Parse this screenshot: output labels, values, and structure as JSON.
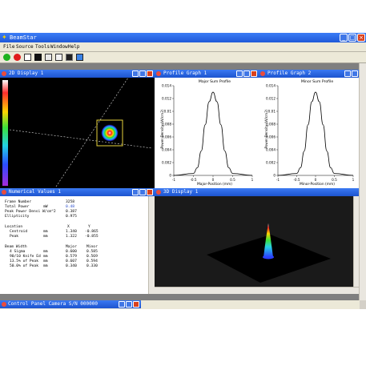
{
  "app": {
    "title": "BeamStar",
    "icon": "beamstar-app-icon",
    "window_buttons": [
      "_",
      "□",
      "×"
    ]
  },
  "menu": [
    "File",
    "Source",
    "Tools",
    "Window",
    "Help"
  ],
  "toolbar": {
    "buttons": [
      "start-green-icon",
      "stop-red-icon",
      "display-icon",
      "black-square-icon",
      "graph-icon",
      "window-icon",
      "panel-icon",
      "grid-icon"
    ]
  },
  "windows": {
    "display2d": {
      "title": "2D Display 1"
    },
    "profile1": {
      "title": "Profile Graph 1",
      "chart_title": "Major Sum Profile",
      "xlabel": "Major-Position (mm)",
      "ylabel": "Power Density (W/cm2)"
    },
    "profile2": {
      "title": "Profile Graph 2",
      "chart_title": "Minor Sum Profile",
      "xlabel": "Minor-Position (mm)",
      "ylabel": "Power Density (W/cm2)"
    },
    "numerical": {
      "title": "Numerical Values 1"
    },
    "display3d": {
      "title": "3D Display 1"
    },
    "control_panel": {
      "title": "Control Panel Camera S/N 000000"
    }
  },
  "numerical_values": {
    "frame_number_label": "Frame Number",
    "frame_number": "3258",
    "total_power_label": "Total Power",
    "total_power_unit": "mW",
    "total_power": "0.48",
    "peak_power_label": "Peak Power Densi W/cm^2",
    "peak_power": "0.387",
    "ellipticity_label": "Ellipticity",
    "ellipticity": "0.975",
    "location_label": "Location",
    "location_x_header": "X",
    "location_y_header": "Y",
    "centroid_label": "Centroid",
    "centroid_unit": "mm",
    "centroid_x": "1.340",
    "centroid_y": "-0.865",
    "peak_label": "Peak",
    "peak_unit": "mm",
    "peak_x": "1.322",
    "peak_y": "-0.855",
    "beam_width_label": "Beam Width",
    "major_header": "Major",
    "minor_header": "Minor",
    "rows": [
      {
        "label": "4 Sigma",
        "unit": "mm",
        "major": "0.600",
        "minor": "0.585"
      },
      {
        "label": "90/10 Knife Ed",
        "unit": "mm",
        "major": "0.579",
        "minor": "0.569"
      },
      {
        "label": "13.5% of Peak",
        "unit": "mm",
        "major": "0.607",
        "minor": "0.594"
      },
      {
        "label": "50.0% of Peak",
        "unit": "mm",
        "major": "0.340",
        "minor": "0.330"
      }
    ]
  },
  "chart_data": [
    {
      "type": "line",
      "title": "Major Sum Profile",
      "xlabel": "Major-Position (mm)",
      "ylabel": "Power Density (W/cm2)",
      "xlim": [
        -1,
        1
      ],
      "ylim": [
        0,
        0.014
      ],
      "xticks": [
        "-1",
        "-0.5",
        "0",
        "0.5",
        "1"
      ],
      "yticks": [
        "0",
        "0.002",
        "0.004",
        "0.006",
        "0.008",
        "0.01",
        "0.012",
        "0.014"
      ],
      "series": [
        {
          "x": [
            -1,
            -0.5,
            -0.4,
            -0.3,
            -0.2,
            -0.1,
            0,
            0.1,
            0.2,
            0.3,
            0.4,
            0.5,
            1
          ],
          "y": [
            0,
            0.0003,
            0.0012,
            0.0038,
            0.0079,
            0.0115,
            0.013,
            0.0115,
            0.0079,
            0.0038,
            0.0012,
            0.0003,
            0
          ]
        }
      ]
    },
    {
      "type": "line",
      "title": "Minor Sum Profile",
      "xlabel": "Minor-Position (mm)",
      "ylabel": "Power Density (W/cm2)",
      "xlim": [
        -1,
        1
      ],
      "ylim": [
        0,
        0.014
      ],
      "xticks": [
        "-1",
        "-0.5",
        "0",
        "0.5",
        "1"
      ],
      "yticks": [
        "0",
        "0.002",
        "0.004",
        "0.006",
        "0.008",
        "0.01",
        "0.012",
        "0.014"
      ],
      "series": [
        {
          "x": [
            -1,
            -0.5,
            -0.4,
            -0.3,
            -0.2,
            -0.1,
            0,
            0.1,
            0.2,
            0.3,
            0.4,
            0.5,
            1
          ],
          "y": [
            0,
            0.0003,
            0.0012,
            0.0038,
            0.0079,
            0.0115,
            0.013,
            0.0115,
            0.0079,
            0.0038,
            0.0012,
            0.0003,
            0
          ]
        }
      ]
    }
  ]
}
